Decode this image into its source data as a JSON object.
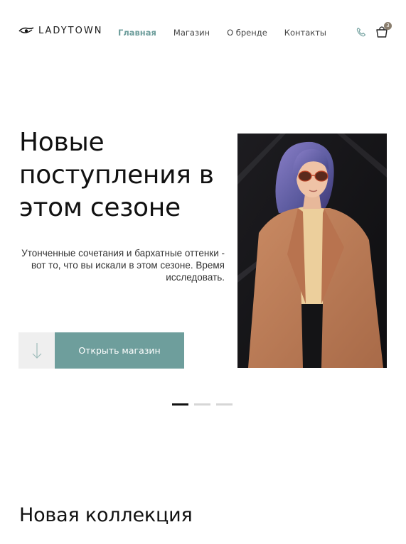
{
  "header": {
    "logo_text": "LADYTOWN",
    "nav": [
      {
        "label": "Главная",
        "active": true
      },
      {
        "label": "Магазин",
        "active": false
      },
      {
        "label": "О бренде",
        "active": false
      },
      {
        "label": "Контакты",
        "active": false
      }
    ],
    "phone_icon": "phone-icon",
    "cart_icon": "shopping-bag-icon",
    "cart_count": "3"
  },
  "hero": {
    "title": "Новые поступления в этом сезоне",
    "text": "Утонченные сочетания и бархатные оттенки - вот то, что вы искали в этом сезоне. Время исследовать.",
    "scroll_icon": "arrow-down-icon",
    "cta_label": "Открыть магазин",
    "accent_color": "#6e9e9c"
  },
  "slider": {
    "slides": 3,
    "active_index": 0
  },
  "collection": {
    "title": "Новая коллекция"
  }
}
